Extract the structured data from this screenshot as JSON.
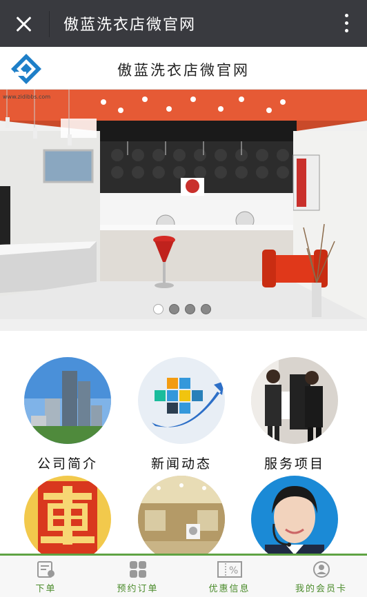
{
  "topbar": {
    "title": "傲蓝洗衣店微官网"
  },
  "header": {
    "title": "傲蓝洗衣店微官网"
  },
  "banner": {
    "watermark": "www.zidibbs.com",
    "slide_count": 4,
    "active_slide": 1
  },
  "menu": [
    {
      "label": "公司简介",
      "icon": "buildings-photo"
    },
    {
      "label": "新闻动态",
      "icon": "cubes-photo"
    },
    {
      "label": "服务项目",
      "icon": "laundry-staff-photo"
    },
    {
      "label": "",
      "icon": "hui-sale-photo"
    },
    {
      "label": "",
      "icon": "store-interior-photo"
    },
    {
      "label": "",
      "icon": "customer-service-photo"
    }
  ],
  "tabbar": {
    "items": [
      {
        "label": "下单",
        "icon": "order-icon"
      },
      {
        "label": "预约订单",
        "icon": "grid-icon"
      },
      {
        "label": "优惠信息",
        "icon": "coupon-icon"
      },
      {
        "label": "我的会员卡",
        "icon": "member-icon"
      }
    ]
  },
  "colors": {
    "topbar": "#393a3f",
    "accent_green": "#5fa343",
    "logo_blue": "#1e7fc8"
  }
}
